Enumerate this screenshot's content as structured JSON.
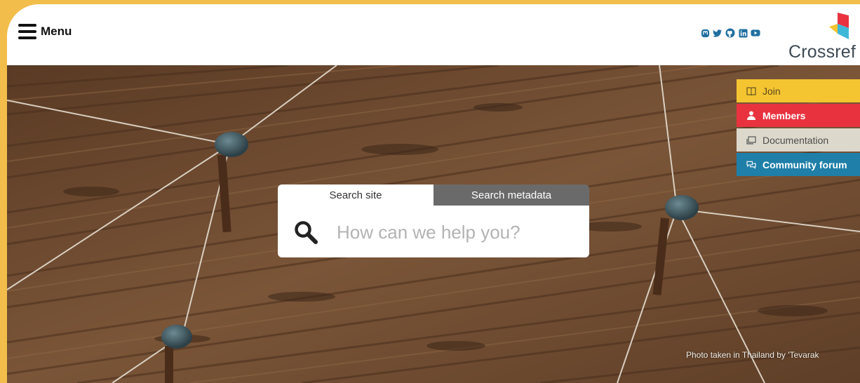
{
  "header": {
    "menu_label": "Menu",
    "logo_text": "Crossref",
    "social": [
      "mastodon-icon",
      "twitter-icon",
      "github-icon",
      "linkedin-icon",
      "youtube-icon"
    ]
  },
  "quick_links": [
    {
      "label": "Join",
      "icon": "book-icon",
      "color": "#f5c431"
    },
    {
      "label": "Members",
      "icon": "person-icon",
      "color": "#e8333f"
    },
    {
      "label": "Documentation",
      "icon": "doc-icon",
      "color": "#dcd8cc"
    },
    {
      "label": "Community forum",
      "icon": "chat-icon",
      "color": "#1f7fa8"
    }
  ],
  "search": {
    "tabs": [
      {
        "label": "Search site",
        "active": true
      },
      {
        "label": "Search metadata",
        "active": false
      }
    ],
    "placeholder": "How can we help you?"
  },
  "hero": {
    "credit": "Photo taken in Thailand by 'Tevarak"
  },
  "colors": {
    "page_border": "#f2bd4a",
    "wood": "#6e4a30",
    "brand_red": "#e8333f",
    "brand_blue": "#1f7fa8"
  }
}
